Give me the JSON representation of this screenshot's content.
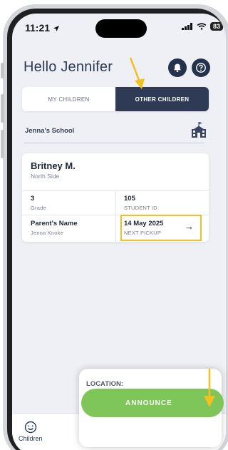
{
  "status_bar": {
    "time": "11:21",
    "battery": "83"
  },
  "header": {
    "greeting": "Hello Jennifer"
  },
  "tabs": [
    {
      "label": "MY CHILDREN",
      "active": false
    },
    {
      "label": "OTHER CHILDREN",
      "active": true
    }
  ],
  "school": {
    "name": "Jenna's School"
  },
  "student": {
    "name": "Britney M.",
    "location": "North Side",
    "grade_value": "3",
    "grade_label": "Grade",
    "student_id_value": "105",
    "student_id_label": "STUDENT ID",
    "parent_label": "Parent's Name",
    "parent_value": "Jenna Knoke",
    "pickup_value": "14 May 2025",
    "pickup_label": "NEXT PICKUP"
  },
  "bottom_nav": {
    "children_label": "Children"
  },
  "popup": {
    "location_label": "LOCATION:",
    "announce_label": "ANNOUNCE"
  },
  "colors": {
    "accent": "#2f3b55",
    "announce": "#7fc65a",
    "highlight": "#f2c01f"
  }
}
